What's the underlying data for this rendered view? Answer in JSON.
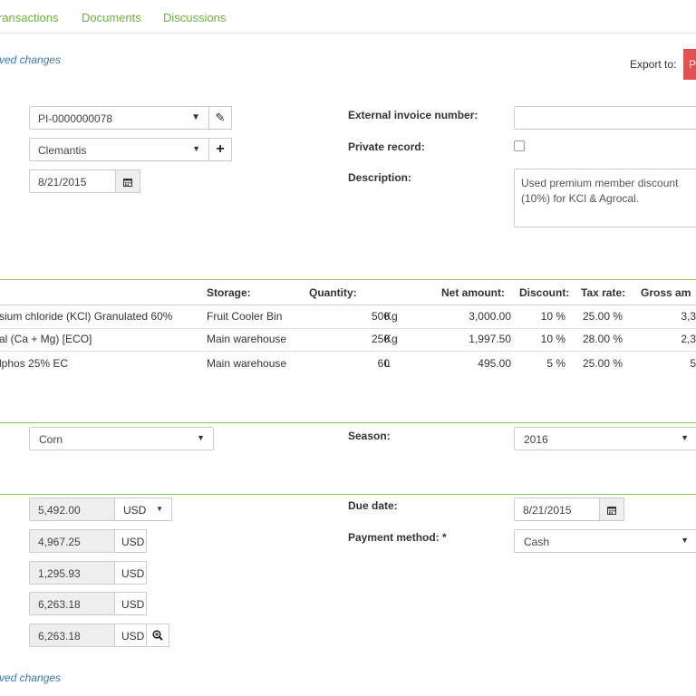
{
  "tabs": [
    "ransactions",
    "Documents",
    "Discussions"
  ],
  "unsaved_top": "ved changes",
  "unsaved_bottom": "ved changes",
  "export_label": "Export to:",
  "export_button_letter": "P",
  "header": {
    "invoice_select": "PI-0000000078",
    "partner_select": "Clemantis",
    "date": "8/21/2015",
    "external_invoice_label": "External invoice number:",
    "external_invoice_value": "",
    "private_label": "Private record:",
    "description_label": "Description:",
    "description_value": "Used premium member discount (10%) for KCl & Agrocal."
  },
  "items_table": {
    "columns": {
      "storage": "Storage:",
      "quantity": "Quantity:",
      "net": "Net amount:",
      "discount": "Discount:",
      "tax": "Tax rate:",
      "gross": "Gross am"
    },
    "rows": [
      {
        "name": "sium chloride (KCl) Granulated 60%",
        "storage": "Fruit Cooler Bin",
        "qty": "500",
        "unit": "Kg",
        "net": "3,000.00",
        "discount": "10 %",
        "tax": "25.00 %",
        "gross": "3,3"
      },
      {
        "name": "al (Ca + Mg) [ECO]",
        "storage": "Main warehouse",
        "qty": "250",
        "unit": "Kg",
        "net": "1,997.50",
        "discount": "10 %",
        "tax": "28.00 %",
        "gross": "2,3"
      },
      {
        "name": "lphos 25% EC",
        "storage": "Main warehouse",
        "qty": "60",
        "unit": "L",
        "net": "495.00",
        "discount": "5 %",
        "tax": "25.00 %",
        "gross": "5"
      }
    ]
  },
  "crop": {
    "crop_select": "Corn",
    "season_label": "Season:",
    "season_select": "2016"
  },
  "totals": {
    "rows": [
      {
        "value": "5,492.00",
        "currency": "USD"
      },
      {
        "value": "4,967.25",
        "currency": "USD"
      },
      {
        "value": "1,295.93",
        "currency": "USD"
      },
      {
        "value": "6,263.18",
        "currency": "USD"
      },
      {
        "value": "6,263.18",
        "currency": "USD"
      }
    ],
    "due_date_label": "Due date:",
    "due_date_value": "8/21/2015",
    "payment_label": "Payment method: *",
    "payment_value": "Cash"
  },
  "colors": {
    "accent_green": "#6bb33c",
    "link_blue": "#3c78b4",
    "export_red": "#e05252"
  }
}
